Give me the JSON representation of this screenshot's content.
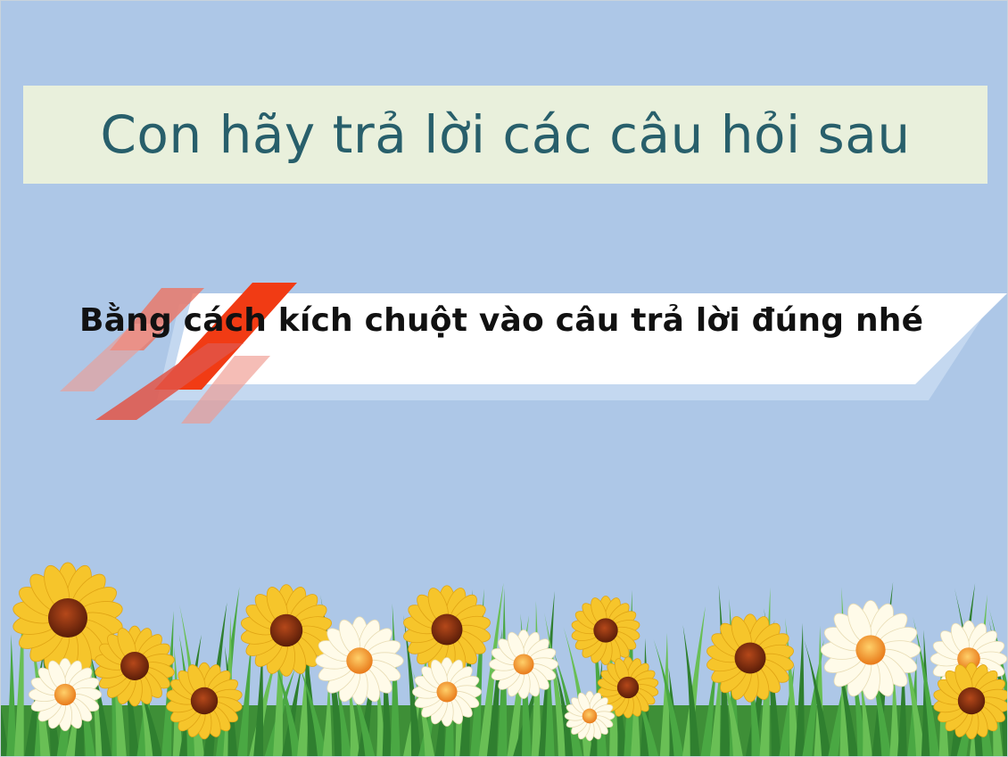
{
  "slide": {
    "title": "Con hãy trả lời các câu hỏi sau",
    "subtitle": "Bằng cách kích chuột vào câu trả lời đúng nhé"
  },
  "colors": {
    "background": "#adc7e7",
    "title_box": "#e9f0dc",
    "title_text": "#285f6b",
    "banner": "#ffffff",
    "banner_shadow": "#c4d8f0",
    "accent": "#f13b14",
    "grass": "#3f9a3a",
    "sunflower_petal": "#f6c52b",
    "sunflower_center": "#8a2f0e",
    "daisy_petal": "#fffbe9",
    "daisy_center": "#f19a2c"
  }
}
